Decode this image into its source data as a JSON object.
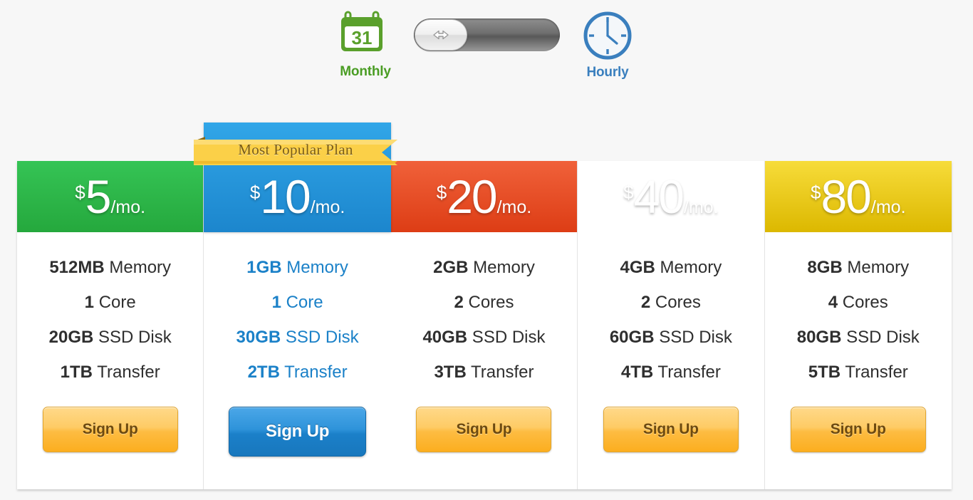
{
  "billing_toggle": {
    "monthly": {
      "label": "Monthly",
      "icon": "calendar-icon",
      "calendar_day": "31",
      "color": "#4a9d24"
    },
    "hourly": {
      "label": "Hourly",
      "icon": "clock-icon",
      "color": "#3a7fbe"
    },
    "switch": {
      "knob_icon": "left-right-arrow-icon",
      "position": "left",
      "selected": "Monthly"
    }
  },
  "ribbon": {
    "text": "Most Popular Plan",
    "color": "#fbd048",
    "text_color": "#7a5c15"
  },
  "plans": [
    {
      "currency": "$",
      "amount": "5",
      "period": "/mo.",
      "header_color": "#2eb745",
      "featured": false,
      "features": [
        {
          "value": "512MB",
          "label": " Memory"
        },
        {
          "value": "1",
          "label": " Core"
        },
        {
          "value": "20GB",
          "label": " SSD Disk"
        },
        {
          "value": "1TB",
          "label": " Transfer"
        }
      ],
      "cta": "Sign Up"
    },
    {
      "currency": "$",
      "amount": "10",
      "period": "/mo.",
      "header_color": "#2196dd",
      "featured": true,
      "features": [
        {
          "value": "1GB",
          "label": " Memory"
        },
        {
          "value": "1",
          "label": " Core"
        },
        {
          "value": "30GB",
          "label": " SSD Disk"
        },
        {
          "value": "2TB",
          "label": " Transfer"
        }
      ],
      "cta": "Sign Up"
    },
    {
      "currency": "$",
      "amount": "20",
      "period": "/mo.",
      "header_color": "#e8552a",
      "featured": false,
      "features": [
        {
          "value": "2GB",
          "label": " Memory"
        },
        {
          "value": "2",
          "label": " Cores"
        },
        {
          "value": "40GB",
          "label": " SSD Disk"
        },
        {
          "value": "3TB",
          "label": " Transfer"
        }
      ],
      "cta": "Sign Up"
    },
    {
      "currency": "$",
      "amount": "40",
      "period": "/mo.",
      "header_color": "#f0a331",
      "featured": false,
      "features": [
        {
          "value": "4GB",
          "label": " Memory"
        },
        {
          "value": "2",
          "label": " Cores"
        },
        {
          "value": "60GB",
          "label": " SSD Disk"
        },
        {
          "value": "4TB",
          "label": " Transfer"
        }
      ],
      "cta": "Sign Up"
    },
    {
      "currency": "$",
      "amount": "80",
      "period": "/mo.",
      "header_color": "#f3cf20",
      "featured": false,
      "features": [
        {
          "value": "8GB",
          "label": " Memory"
        },
        {
          "value": "4",
          "label": " Cores"
        },
        {
          "value": "80GB",
          "label": " SSD Disk"
        },
        {
          "value": "5TB",
          "label": " Transfer"
        }
      ],
      "cta": "Sign Up"
    }
  ]
}
